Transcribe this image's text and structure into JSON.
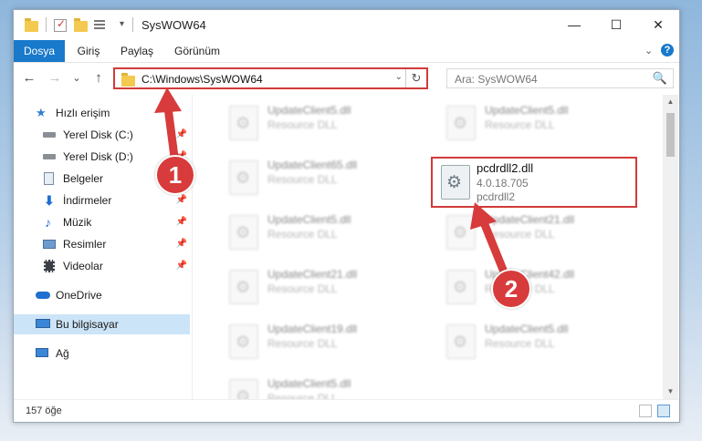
{
  "window": {
    "title": "SysWOW64",
    "minimize": "—",
    "maximize": "☐",
    "close": "✕"
  },
  "ribbon": {
    "tabs": [
      "Dosya",
      "Giriş",
      "Paylaş",
      "Görünüm"
    ],
    "expand": "⌄",
    "help": "?"
  },
  "nav": {
    "back": "←",
    "forward": "→",
    "recent": "⌄",
    "up": "↑",
    "address": "C:\\Windows\\SysWOW64",
    "address_dropdown": "⌄",
    "refresh": "↻",
    "search_placeholder": "Ara: SysWOW64",
    "search_icon": "🔍"
  },
  "sidebar": {
    "items": [
      {
        "label": "Hızlı erişim",
        "icon": "star-icon",
        "pinned": false
      },
      {
        "label": "Yerel Disk (C:)",
        "icon": "drive-icon",
        "pinned": true
      },
      {
        "label": "Yerel Disk (D:)",
        "icon": "drive-icon",
        "pinned": true
      },
      {
        "label": "Belgeler",
        "icon": "documents-icon",
        "pinned": true
      },
      {
        "label": "İndirmeler",
        "icon": "download-icon",
        "pinned": true
      },
      {
        "label": "Müzik",
        "icon": "music-icon",
        "pinned": true
      },
      {
        "label": "Resimler",
        "icon": "pictures-icon",
        "pinned": true
      },
      {
        "label": "Videolar",
        "icon": "video-icon",
        "pinned": true
      },
      {
        "label": "OneDrive",
        "icon": "cloud-icon",
        "pinned": false
      },
      {
        "label": "Bu bilgisayar",
        "icon": "computer-icon",
        "pinned": false,
        "selected": true
      },
      {
        "label": "Ağ",
        "icon": "network-icon",
        "pinned": false
      }
    ],
    "pin_glyph": "📌"
  },
  "files": {
    "left_column": [
      {
        "name": "UpdateClient5.dll",
        "type": "Resource DLL"
      },
      {
        "name": "UpdateClient65.dll",
        "type": "Resource DLL"
      },
      {
        "name": "UpdateClient5.dll",
        "type": "Resource DLL"
      },
      {
        "name": "UpdateClient21.dll",
        "type": "Resource DLL"
      },
      {
        "name": "UpdateClient19.dll",
        "type": "Resource DLL"
      },
      {
        "name": "UpdateClient5.dll",
        "type": "Resource DLL"
      }
    ],
    "right_column": [
      {
        "name": "UpdateClient5.dll",
        "type": "Resource DLL"
      },
      {
        "name": "UpdateClient21.dll",
        "type": "Resource DLL"
      },
      {
        "name": "UpdateClient42.dll",
        "type": "Resource DLL"
      },
      {
        "name": "UpdateClient5.dll",
        "type": "Resource DLL"
      }
    ],
    "highlighted": {
      "name": "pcdrdll2.dll",
      "version": "4.0.18.705",
      "description": "pcdrdll2"
    }
  },
  "callouts": {
    "one": "1",
    "two": "2"
  },
  "status": {
    "item_count": "157 öğe"
  },
  "colors": {
    "accent": "#1979ca",
    "highlight": "#d23a3a",
    "selected": "#cce4f7"
  }
}
